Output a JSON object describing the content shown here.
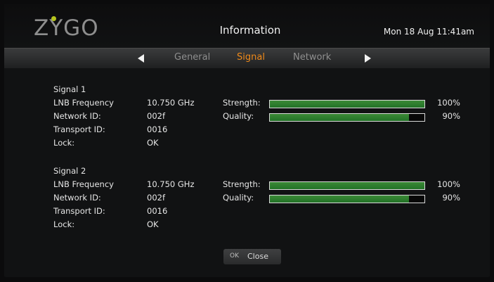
{
  "header": {
    "logo": "ZYGO",
    "title": "Information",
    "datetime": "Mon 18 Aug 11:41am"
  },
  "tabs": [
    {
      "label": "General",
      "active": false
    },
    {
      "label": "Signal",
      "active": true
    },
    {
      "label": "Network",
      "active": false
    }
  ],
  "signals": [
    {
      "title": "Signal 1",
      "rows": [
        {
          "label": "LNB Frequency",
          "value": "10.750 GHz"
        },
        {
          "label": "Network ID:",
          "value": "002f"
        },
        {
          "label": "Transport ID:",
          "value": "0016"
        },
        {
          "label": "Lock:",
          "value": "OK"
        }
      ],
      "meters": [
        {
          "label": "Strength:",
          "percent": 100,
          "display": "100%"
        },
        {
          "label": "Quality:",
          "percent": 90,
          "display": "90%"
        }
      ]
    },
    {
      "title": "Signal 2",
      "rows": [
        {
          "label": "LNB Frequency",
          "value": "10.750 GHz"
        },
        {
          "label": "Network ID:",
          "value": "002f"
        },
        {
          "label": "Transport ID:",
          "value": "0016"
        },
        {
          "label": "Lock:",
          "value": "OK"
        }
      ],
      "meters": [
        {
          "label": "Strength:",
          "percent": 100,
          "display": "100%"
        },
        {
          "label": "Quality:",
          "percent": 90,
          "display": "90%"
        }
      ]
    }
  ],
  "footer": {
    "ok_key": "OK",
    "close_label": "Close"
  },
  "colors": {
    "active_tab": "#ef8a1a",
    "bar_fill": "#2f7f2f",
    "logo_dot": "#b6c51e"
  }
}
